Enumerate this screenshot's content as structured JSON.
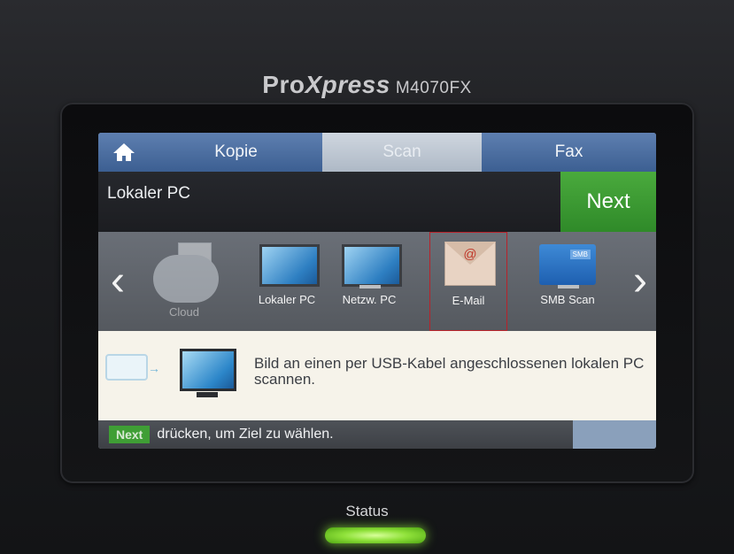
{
  "device": {
    "brand_pro": "Pro",
    "brand_xpress": "Xpress",
    "model": "M4070FX",
    "status_label": "Status"
  },
  "tabs": [
    {
      "label": "Kopie",
      "active": false
    },
    {
      "label": "Scan",
      "active": true
    },
    {
      "label": "Fax",
      "active": false
    }
  ],
  "header": {
    "title": "Lokaler PC",
    "next_label": "Next"
  },
  "destinations": [
    {
      "label": "Cloud",
      "icon": "cloud-icon",
      "dimmed": true
    },
    {
      "label": "Lokaler PC",
      "icon": "monitor-icon"
    },
    {
      "label": "Netzw. PC",
      "icon": "network-monitor-icon"
    },
    {
      "label": "E-Mail",
      "icon": "email-envelope-icon",
      "selected": true,
      "at_symbol": "@"
    },
    {
      "label": "SMB Scan",
      "icon": "smb-folder-icon",
      "tag": "SMB"
    }
  ],
  "info": {
    "text": "Bild an einen per USB-Kabel angeschlossenen lokalen PC scannen."
  },
  "statusbar": {
    "next_badge": "Next",
    "text": "drücken, um Ziel zu wählen."
  },
  "colors": {
    "accent_green": "#3f9e35",
    "tab_blue": "#3c5f92",
    "led_green": "#8fe13a"
  }
}
